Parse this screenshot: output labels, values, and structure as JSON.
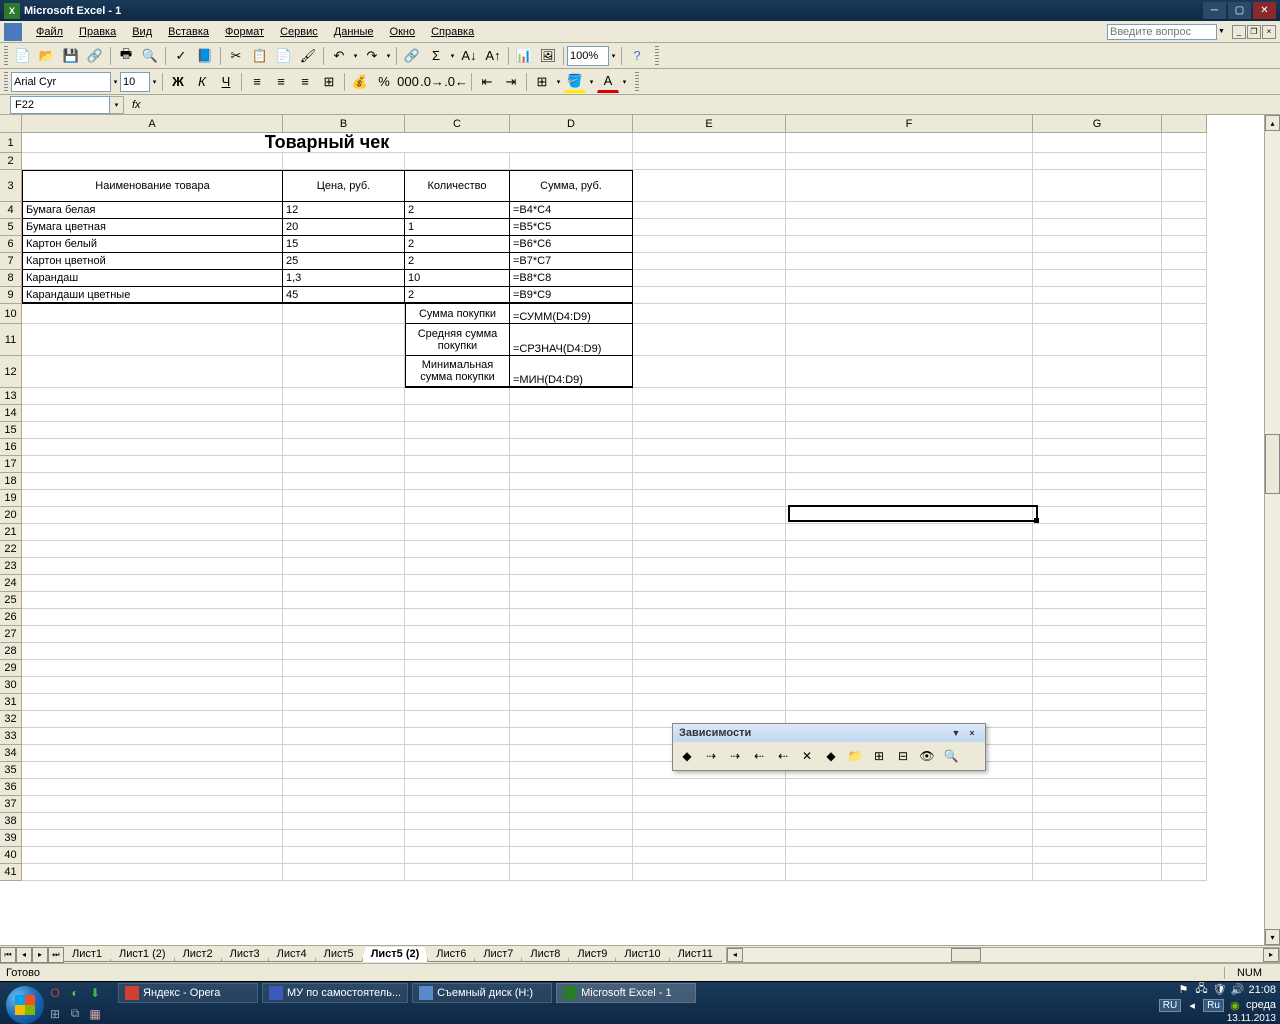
{
  "window": {
    "title": "Microsoft Excel - 1"
  },
  "menu": {
    "items": [
      "Файл",
      "Правка",
      "Вид",
      "Вставка",
      "Формат",
      "Сервис",
      "Данные",
      "Окно",
      "Справка"
    ],
    "help_placeholder": "Введите вопрос"
  },
  "toolbar1": {
    "zoom": "100%"
  },
  "toolbar2": {
    "font": "Arial Cyr",
    "size": "10"
  },
  "namebox": {
    "value": "F22"
  },
  "columns": [
    "A",
    "B",
    "C",
    "D",
    "E",
    "F",
    "G"
  ],
  "sheet": {
    "title": "Товарный чек",
    "headers": {
      "a": "Наименование товара",
      "b": "Цена, руб.",
      "c": "Количество",
      "d": "Сумма, руб."
    },
    "rows": [
      {
        "a": "Бумага белая",
        "b": "12",
        "c": "2",
        "d": "=B4*C4"
      },
      {
        "a": "Бумага цветная",
        "b": "20",
        "c": "1",
        "d": "=B5*C5"
      },
      {
        "a": "Картон белый",
        "b": "15",
        "c": "2",
        "d": "=B6*C6"
      },
      {
        "a": "Картон цветной",
        "b": "25",
        "c": "2",
        "d": "=B7*C7"
      },
      {
        "a": "Карандаш",
        "b": "1,3",
        "c": "10",
        "d": "=B8*C8"
      },
      {
        "a": "Карандаши цветные",
        "b": "45",
        "c": "2",
        "d": "=B9*C9"
      }
    ],
    "summary": [
      {
        "label": "Сумма покупки",
        "formula": "=СУММ(D4:D9)"
      },
      {
        "label": "Средняя сумма покупки",
        "formula": "=СРЗНАЧ(D4:D9)"
      },
      {
        "label": "Минимальная сумма покупки",
        "formula": "=МИН(D4:D9)"
      }
    ]
  },
  "deps_toolbar": {
    "title": "Зависимости"
  },
  "tabs": [
    "Лист1",
    "Лист1 (2)",
    "Лист2",
    "Лист3",
    "Лист4",
    "Лист5",
    "Лист5 (2)",
    "Лист6",
    "Лист7",
    "Лист8",
    "Лист9",
    "Лист10",
    "Лист11"
  ],
  "active_tab": "Лист5 (2)",
  "statusbar": {
    "ready": "Готово",
    "num": "NUM"
  },
  "taskbar": {
    "items": [
      {
        "label": "Яндекс - Opera",
        "color": "#d04030"
      },
      {
        "label": "МУ по самостоятель...",
        "color": "#3a5aba"
      },
      {
        "label": "Съемный диск (H:)",
        "color": "#5a8aca"
      },
      {
        "label": "Microsoft Excel - 1",
        "color": "#2a7a2a"
      }
    ],
    "lang1": "RU",
    "lang2": "Ru",
    "time": "21:08",
    "day": "среда",
    "date": "13.11.2013"
  }
}
